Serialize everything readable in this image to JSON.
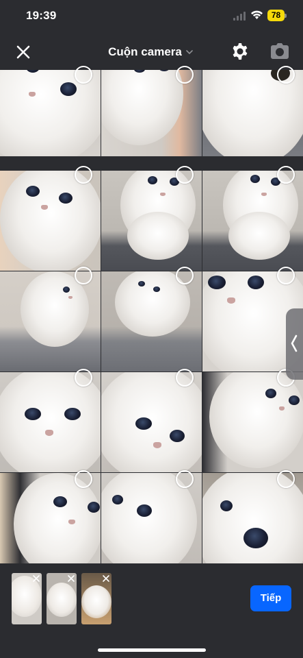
{
  "status_bar": {
    "time": "19:39",
    "battery_level": "78",
    "battery_color": "#f5d90a"
  },
  "header": {
    "title": "Cuộn camera",
    "icons": [
      "close-icon",
      "chevron-down-icon",
      "gear-icon",
      "camera-icon"
    ]
  },
  "grid": {
    "columns": 3,
    "visible_photo_count": 15,
    "photo_subject": "white kitten",
    "selection": "unselected"
  },
  "tray": {
    "selected_count": 3,
    "next_label": "Tiếp",
    "accent_color": "#0866ff"
  }
}
